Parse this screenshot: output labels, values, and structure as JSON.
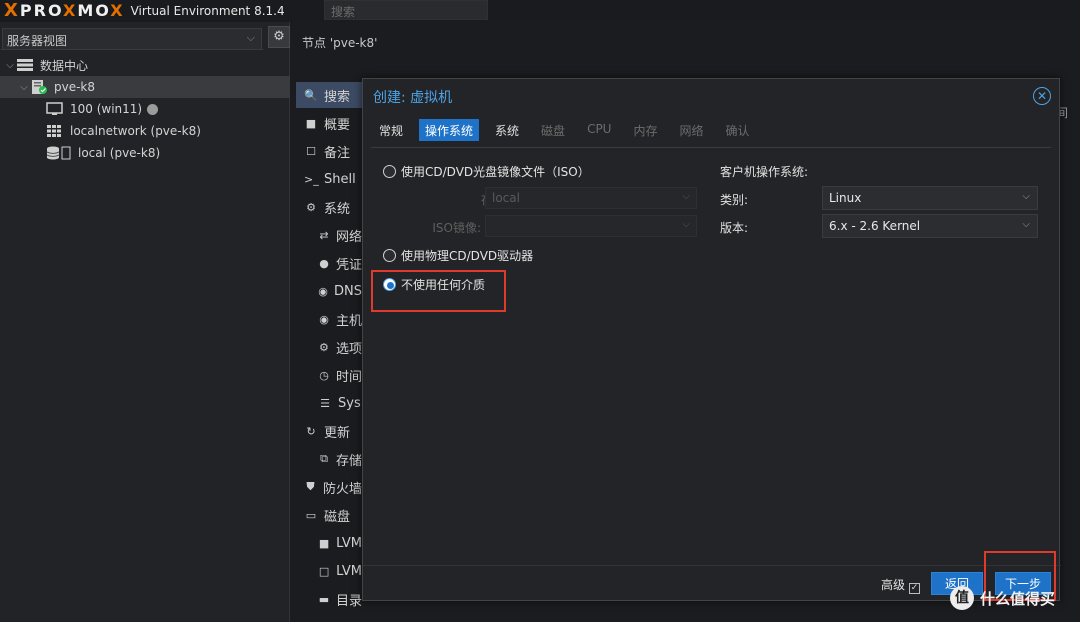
{
  "header": {
    "logo_x": "X",
    "logo_brand_a": "PRO",
    "logo_brand_x": "X",
    "logo_brand_b": "MO",
    "logo_brand_x2": "X",
    "version": "Virtual Environment 8.1.4",
    "search_placeholder": "搜索"
  },
  "sidebar": {
    "view_selector": "服务器视图",
    "tree": [
      {
        "label": "数据中心"
      },
      {
        "label": "pve-k8"
      },
      {
        "label": "100 (win11)"
      },
      {
        "label": "localnetwork (pve-k8)"
      },
      {
        "label": "local (pve-k8)"
      }
    ]
  },
  "breadcrumb": "节点 'pve-k8'",
  "node_nav": [
    {
      "label": "搜索"
    },
    {
      "label": "概要"
    },
    {
      "label": "备注"
    },
    {
      "label": "Shell"
    },
    {
      "label": "系统"
    },
    {
      "label": "网络"
    },
    {
      "label": "凭证"
    },
    {
      "label": "DNS"
    },
    {
      "label": "主机"
    },
    {
      "label": "选项"
    },
    {
      "label": "时间"
    },
    {
      "label": "Sys"
    },
    {
      "label": "更新"
    },
    {
      "label": "存储"
    },
    {
      "label": "防火墙"
    },
    {
      "label": "磁盘"
    },
    {
      "label": "LVM"
    },
    {
      "label": "LVM"
    },
    {
      "label": "目录"
    }
  ],
  "bg_right_hint": "间",
  "dialog": {
    "title": "创建: 虚拟机",
    "tabs": [
      {
        "label": "常规"
      },
      {
        "label": "操作系统"
      },
      {
        "label": "系统"
      },
      {
        "label": "磁盘"
      },
      {
        "label": "CPU"
      },
      {
        "label": "内存"
      },
      {
        "label": "网络"
      },
      {
        "label": "确认"
      }
    ],
    "media_options": {
      "iso": "使用CD/DVD光盘镜像文件（ISO）",
      "storage_label": "存储:",
      "storage_value": "local",
      "iso_label": "ISO镜像:",
      "iso_value": "",
      "physical": "使用物理CD/DVD驱动器",
      "none": "不使用任何介质"
    },
    "guest_os": {
      "heading": "客户机操作系统:",
      "type_label": "类别:",
      "type_value": "Linux",
      "version_label": "版本:",
      "version_value": "6.x - 2.6 Kernel"
    },
    "footer": {
      "advanced_label": "高级",
      "back_button": "返回",
      "next_button": "下一步"
    }
  },
  "watermark": {
    "badge": "值",
    "text": "什么值得买"
  }
}
